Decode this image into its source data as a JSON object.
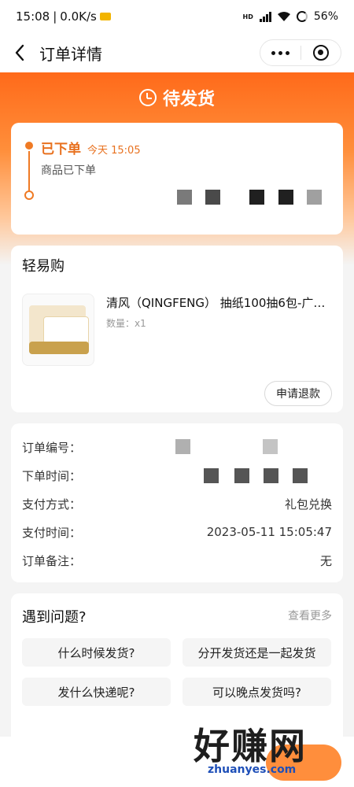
{
  "status_bar": {
    "time": "15:08",
    "network_speed": "0.0K/s",
    "signal_tag": "HD",
    "battery": "56%"
  },
  "nav": {
    "title": "订单详情",
    "back_icon": "chevron-left-icon",
    "more_icon": "more-dots-icon",
    "close_icon": "target-icon"
  },
  "order_status": {
    "label": "待发货",
    "icon": "clock-icon",
    "color": "#ff6a1a"
  },
  "timeline": {
    "status": "已下单",
    "time": "今天 15:05",
    "description": "商品已下单"
  },
  "shop": {
    "name": "轻易购"
  },
  "product": {
    "name": "清风（QINGFENG） 抽纸100抽6包-广…",
    "qty_label": "数量：x1"
  },
  "refund_button": "申请退款",
  "order_info": {
    "rows": [
      {
        "label": "订单编号：",
        "value": ""
      },
      {
        "label": "下单时间：",
        "value": ""
      },
      {
        "label": "支付方式：",
        "value": "礼包兑换"
      },
      {
        "label": "支付时间：",
        "value": "2023-05-11 15:05:47"
      },
      {
        "label": "订单备注：",
        "value": "无"
      }
    ]
  },
  "faq": {
    "title": "遇到问题?",
    "more": "查看更多",
    "questions": [
      "什么时候发货?",
      "分开发货还是一起发货",
      "发什么快递呢?",
      "可以晚点发货吗?"
    ]
  },
  "watermark": {
    "main": "好赚网",
    "sub": "zhuanyes.com"
  },
  "accent_color": "#e8711f"
}
